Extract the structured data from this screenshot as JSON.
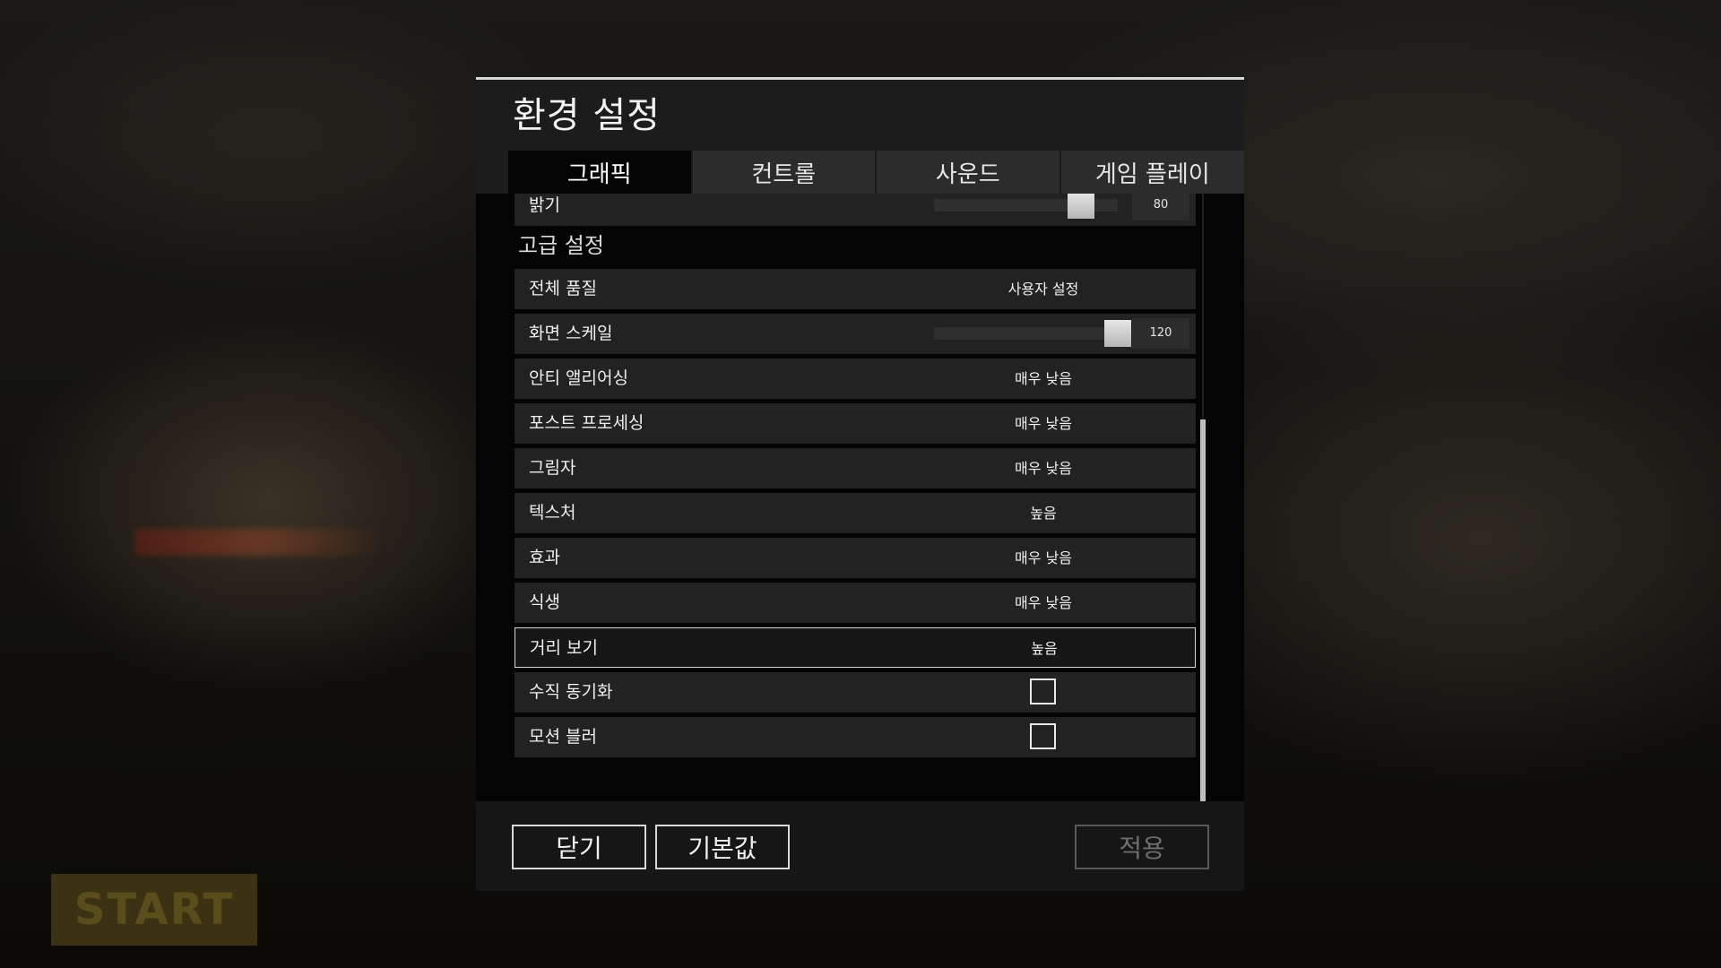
{
  "dialog": {
    "title": "환경 설정"
  },
  "tabs": [
    {
      "label": "그래픽",
      "active": true
    },
    {
      "label": "컨트롤",
      "active": false
    },
    {
      "label": "사운드",
      "active": false
    },
    {
      "label": "게임 플레이",
      "active": false
    }
  ],
  "brightness": {
    "label": "밝기",
    "value": "80",
    "fraction": 0.8
  },
  "advanced": {
    "section_title": "고급 설정",
    "overall_quality": {
      "label": "전체 품질",
      "value": "사용자 설정"
    },
    "screen_scale": {
      "label": "화면 스케일",
      "value": "120",
      "fraction": 1.0
    },
    "anti_aliasing": {
      "label": "안티 앨리어싱",
      "value": "매우 낮음"
    },
    "post_processing": {
      "label": "포스트 프로세싱",
      "value": "매우 낮음"
    },
    "shadows": {
      "label": "그림자",
      "value": "매우 낮음"
    },
    "texture": {
      "label": "텍스처",
      "value": "높음"
    },
    "effects": {
      "label": "효과",
      "value": "매우 낮음"
    },
    "foliage": {
      "label": "식생",
      "value": "매우 낮음"
    },
    "view_distance": {
      "label": "거리 보기",
      "value": "높음",
      "selected": true
    },
    "vsync": {
      "label": "수직 동기화",
      "checked": false
    },
    "motion_blur": {
      "label": "모션 블러",
      "checked": false
    }
  },
  "footer": {
    "close_label": "닫기",
    "default_label": "기본값",
    "apply_label": "적용",
    "apply_enabled": false
  },
  "background": {
    "start_label": "START"
  },
  "colors": {
    "panel": "#1c1c1c",
    "content": "#040404",
    "row": "#222222",
    "tab_inactive": "#2c2c2c",
    "text": "#f0f0f0"
  }
}
